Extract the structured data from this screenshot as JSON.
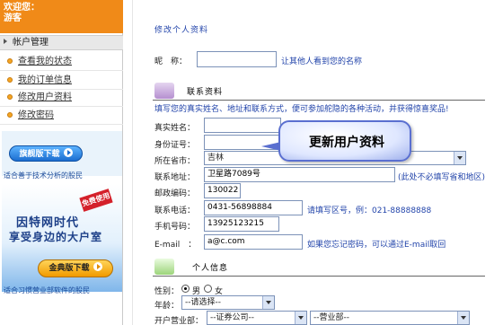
{
  "sidebar": {
    "welcome_line1": "欢迎您：",
    "welcome_line2": "游客",
    "account_header": "帐户管理",
    "items": [
      {
        "label": "查看我的状态"
      },
      {
        "label": "我的订单信息"
      },
      {
        "label": "修改用户资料"
      },
      {
        "label": "修改密码"
      }
    ],
    "banner1": {
      "button": "旗舰版下载",
      "caption": "适合善于技术分析的股民"
    },
    "banner2": {
      "tag": "免费使用",
      "line1": "因特网时代",
      "line2": "享受身边的大户室",
      "button": "金典版下载",
      "caption": "适合习惯营业部软件的股民"
    }
  },
  "main": {
    "title": "修改个人资料",
    "nickname": {
      "label": "昵　称：",
      "value": "",
      "hint": "让其他人看到您的名称"
    },
    "section_contact": {
      "title": "联系资料",
      "description": "填写您的真实姓名、地址和联系方式，便可参加舵隐的各种活动，并获得惊喜奖品!"
    },
    "fields": {
      "real_name": {
        "label": "真实姓名：",
        "value": ""
      },
      "id_number": {
        "label": "身份证号：",
        "value": ""
      },
      "province": {
        "label": "所在省市：",
        "value": "吉林"
      },
      "address": {
        "label": "联系地址：",
        "value": "卫星路7089号",
        "hint": "(此处不必填写省和地区)"
      },
      "postcode": {
        "label": "邮政编码：",
        "value": "130022"
      },
      "phone": {
        "label": "联系电话：",
        "value": "0431-56898884",
        "hint": "请填写区号，例：021-88888888"
      },
      "mobile": {
        "label": "手机号码：",
        "value": "13925123215"
      },
      "email": {
        "label": "E-mail　：",
        "value": "a@c.com",
        "hint": "如果您忘记密码，可以通过E-mail取回"
      }
    },
    "section_personal": {
      "title": "个人信息",
      "gender": {
        "label": "性别：",
        "male": "男",
        "female": "女"
      },
      "age": {
        "label": "年龄：",
        "value": "--请选择--"
      },
      "branch": {
        "label": "开户营业部：",
        "company": "--证券公司--",
        "department": "--营业部--"
      }
    },
    "callout": "更新用户资料"
  },
  "colors": {
    "accent_orange": "#f08a18",
    "link_blue": "#2244aa",
    "callout_border": "#5a6fd0"
  }
}
